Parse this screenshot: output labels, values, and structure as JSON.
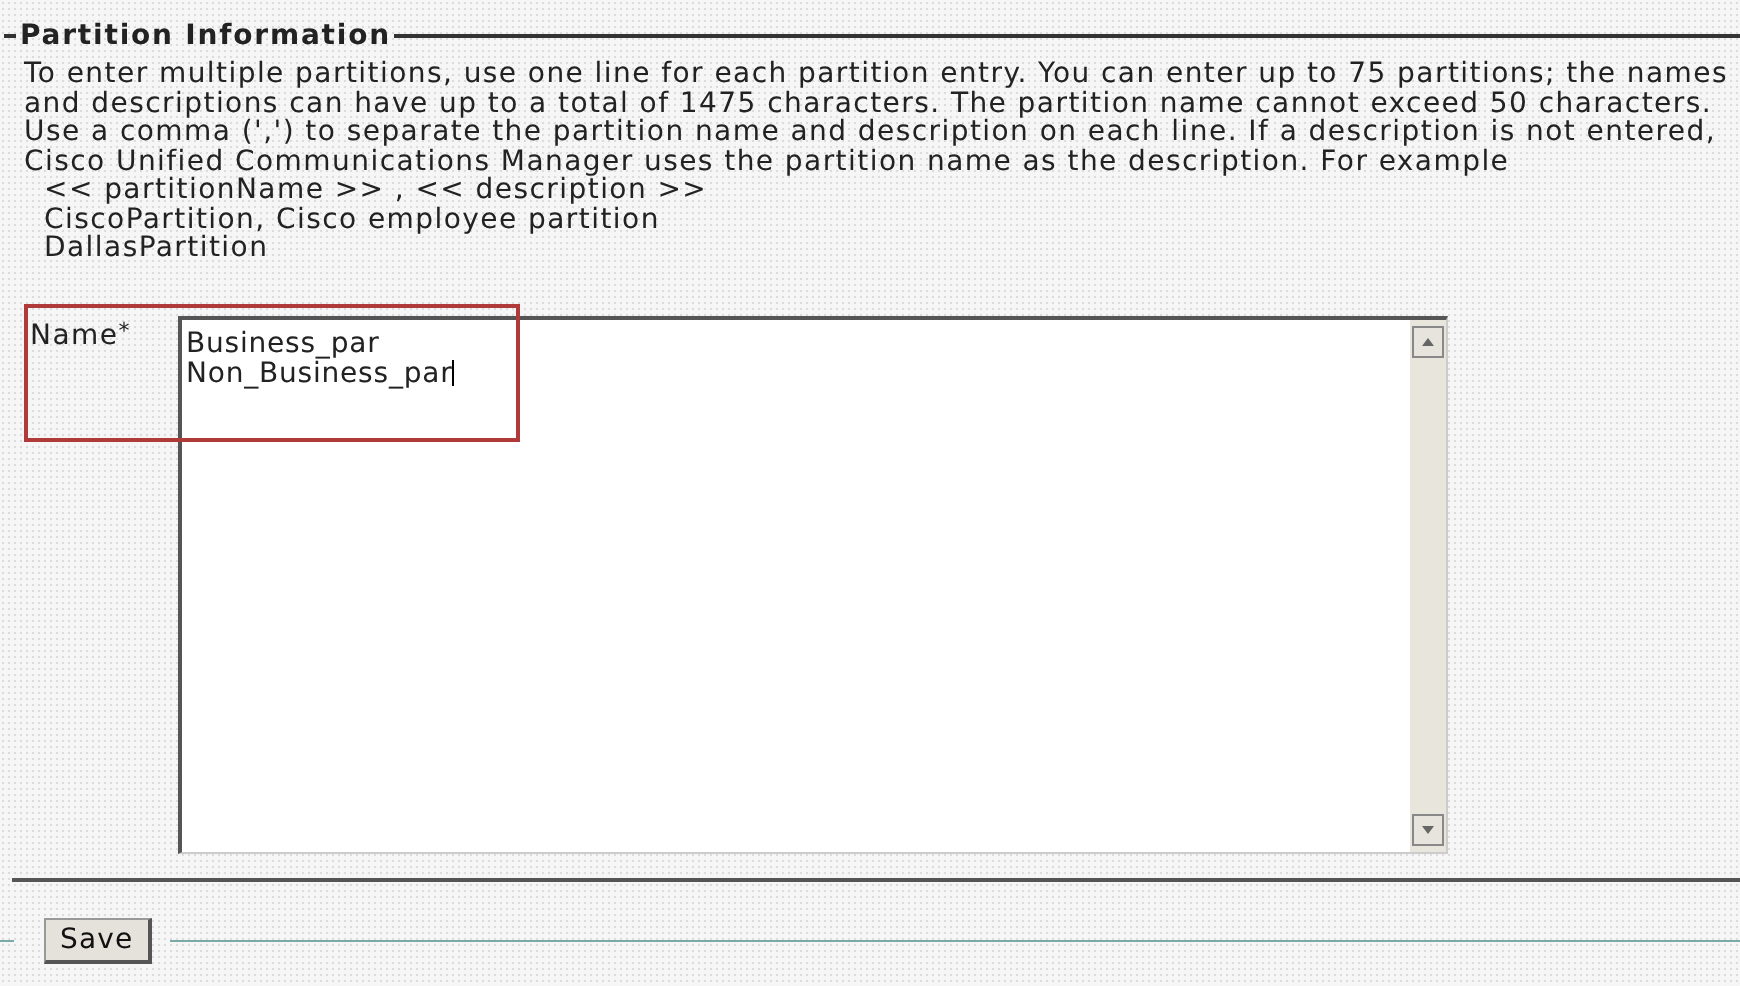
{
  "section": {
    "title": "Partition Information",
    "instructions": "To enter multiple partitions, use one line for each partition entry. You can enter up to 75 partitions; the names and descriptions can have up to a total of 1475 characters. The partition name cannot exceed 50 characters. Use a comma (',') to separate the partition name and description on each line. If a description is not entered, Cisco Unified Communications Manager uses the partition name as the description. For example",
    "examples": [
      "<< partitionName >> , << description >>",
      "CiscoPartition, Cisco employee partition",
      "DallasPartition"
    ]
  },
  "name_field": {
    "label": "Name",
    "required_mark": "*",
    "lines": [
      "Business_par",
      "Non_Business_par"
    ],
    "highlighted": true
  },
  "buttons": [
    "Save"
  ]
}
